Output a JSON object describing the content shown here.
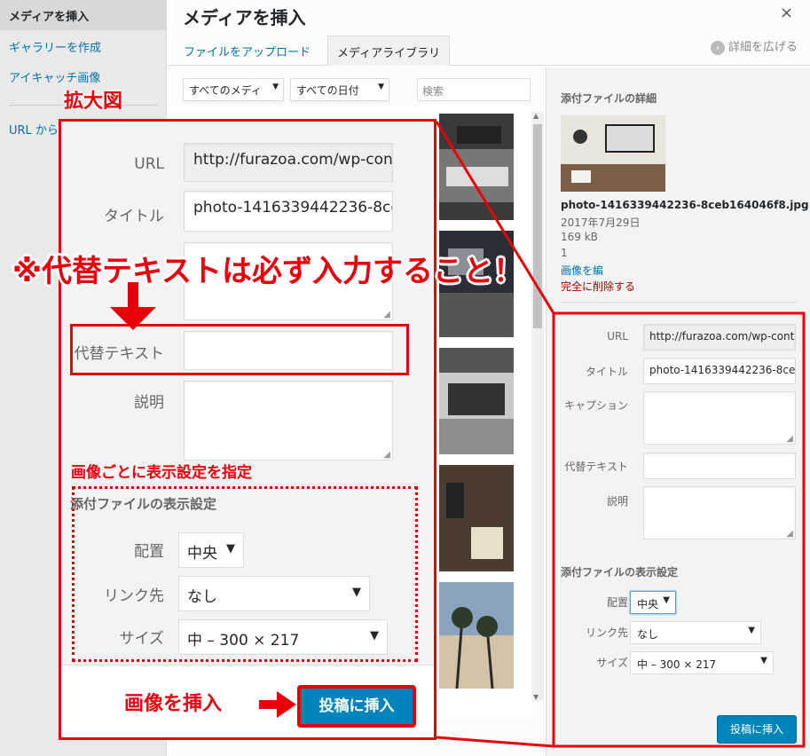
{
  "sidebar": {
    "active": "メディアを挿入",
    "items": [
      "ギャラリーを作成",
      "アイキャッチ画像",
      "URL から"
    ]
  },
  "modal": {
    "title": "メディアを挿入",
    "close": "×",
    "tabs": [
      "ファイルをアップロード",
      "メディアライブラリ"
    ],
    "expand": "詳細を広げる",
    "filters": {
      "type": "すべてのメディ",
      "date": "すべての日付"
    },
    "search_placeholder": "検索"
  },
  "details": {
    "heading": "添付ファイルの詳細",
    "filename": "photo-1416339442236-8ceb164046f8.jpg",
    "date": "2017年7月29日",
    "size": "169 kB",
    "dimensions": "1",
    "edit": "画像を編",
    "delete": "完全に削除する",
    "fields": {
      "url_label": "URL",
      "url_value": "http://furazoa.com/wp-cont",
      "title_label": "タイトル",
      "title_value": "photo-1416339442236-8ceb",
      "caption_label": "キャプション",
      "alt_label": "代替テキスト",
      "desc_label": "説明"
    },
    "display_heading": "添付ファイルの表示設定",
    "align_label": "配置",
    "align_value": "中央",
    "link_label": "リンク先",
    "link_value": "なし",
    "size_label": "サイズ",
    "size_value": "中 – 300 × 217",
    "insert_button": "投稿に挿入"
  },
  "zoom": {
    "url_label": "URL",
    "url_value": "http://furazoa.com/wp-con",
    "title_label": "タイトル",
    "title_value": "photo-1416339442236-8ce",
    "alt_label": "代替テキスト",
    "desc_label": "説明",
    "display_heading": "添付ファイルの表示設定",
    "align_label": "配置",
    "align_value": "中央",
    "link_label": "リンク先",
    "link_value": "なし",
    "size_label": "サイズ",
    "size_value": "中 – 300 × 217",
    "insert_button": "投稿に挿入"
  },
  "annotations": {
    "kakudai": "拡大図",
    "required": "※代替テキストは必ず入力すること！",
    "per_image": "画像ごとに表示設定を指定",
    "insert_image": "画像を挿入"
  },
  "colors": {
    "accent": "#e8000b",
    "primary_button": "#0085ba",
    "link": "#0073aa"
  }
}
